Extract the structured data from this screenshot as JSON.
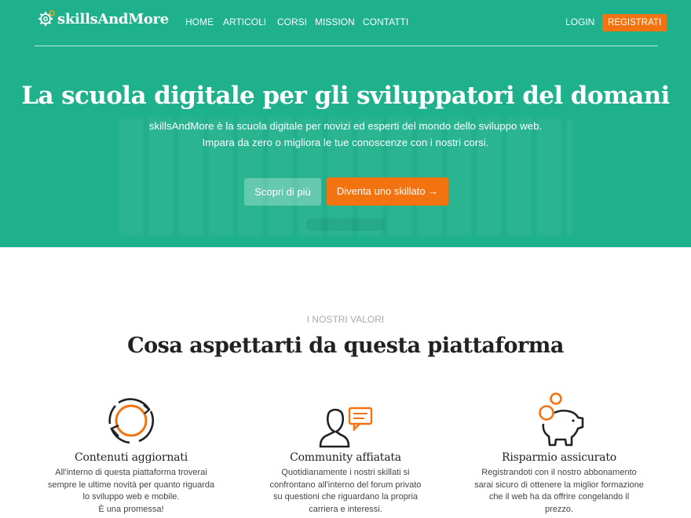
{
  "brand": {
    "name": "skillsAndMore"
  },
  "nav": {
    "items": [
      "HOME",
      "ARTICOLI",
      "CORSI",
      "MISSION",
      "CONTATTI"
    ],
    "login": "LOGIN",
    "register": "REGISTRATI"
  },
  "hero": {
    "title": "La scuola digitale per gli sviluppatori del domani",
    "subtitle_line1": "skillsAndMore è la scuola digitale per novizi ed esperti del mondo dello sviluppo web.",
    "subtitle_line2": "Impara da zero o migliora le tue conoscenze con i nostri corsi.",
    "btn_secondary": "Scopri di più",
    "btn_primary": "Diventa uno skillato →"
  },
  "values": {
    "kicker": "I NOSTRI VALORI",
    "title": "Cosa aspettarti da questa piattaforma",
    "features": [
      {
        "icon": "refresh-icon",
        "title": "Contenuti aggiornati",
        "lines": [
          "All'interno di questa piattaforma troverai",
          "sempre le ultime novità per quanto riguarda",
          "lo sviluppo web e mobile.",
          "È una promessa!"
        ]
      },
      {
        "icon": "community-icon",
        "title": "Community affiatata",
        "lines": [
          "Quotidianamente i nostri skillati si",
          "confrontano all'interno del forum privato",
          "su questioni che riguardano la propria",
          "carriera e interessi."
        ]
      },
      {
        "icon": "piggy-bank-icon",
        "title": "Risparmio assicurato",
        "lines": [
          "Registrandoti con il nostro abbonamento",
          "sarai sicuro di ottenere la miglior formazione",
          "che il web ha da offrire congelando il",
          "prezzo."
        ]
      }
    ]
  },
  "colors": {
    "primary": "#1fb18b",
    "accent": "#f2730f"
  }
}
